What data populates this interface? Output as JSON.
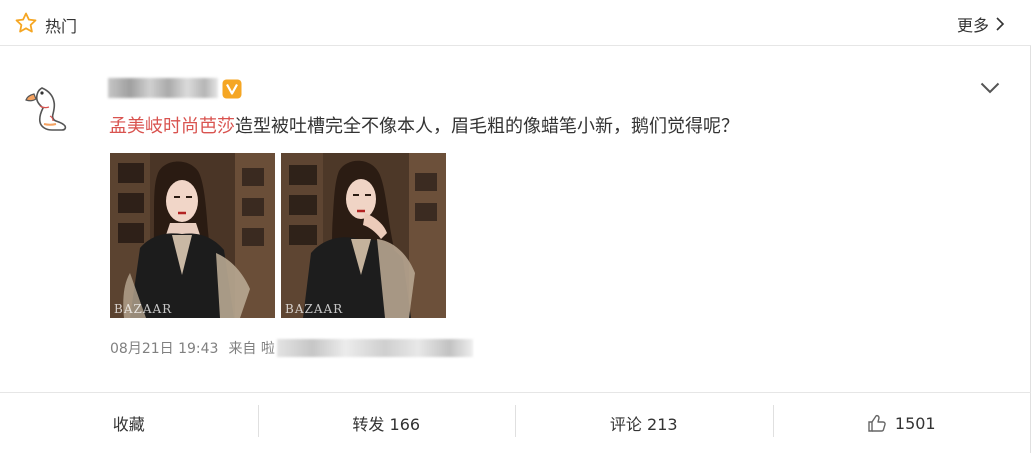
{
  "header": {
    "title": "热门",
    "more_label": "更多",
    "icons": {
      "star": "star-outline-icon",
      "more": "chevron-right-icon"
    }
  },
  "post": {
    "author_name": "",
    "badge": "V",
    "mention": "孟美岐时尚芭莎",
    "text": "造型被吐槽完全不像本人，眉毛粗的像蜡笔小新，鹅们觉得呢？",
    "images": [
      {
        "watermark": "BAZAAR"
      },
      {
        "watermark": "BAZAAR"
      }
    ],
    "timestamp": "08月21日 19:43",
    "source_prefix": "来自 啦",
    "colors": {
      "mention": "#d9534f",
      "badge": "#f5a623",
      "meta": "#808080"
    }
  },
  "actions": {
    "favorite": "收藏",
    "repost": "转发 166",
    "comment": "评论 213",
    "like": "1501"
  }
}
